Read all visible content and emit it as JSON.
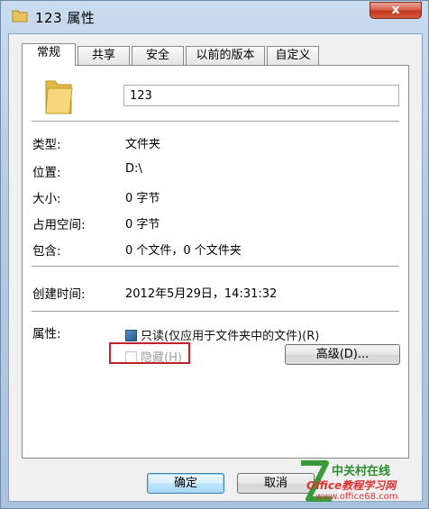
{
  "window": {
    "title": "123 属性",
    "close_glyph": "x"
  },
  "tabs": [
    {
      "label": "常规",
      "active": true
    },
    {
      "label": "共享",
      "active": false
    },
    {
      "label": "安全",
      "active": false
    },
    {
      "label": "以前的版本",
      "active": false
    },
    {
      "label": "自定义",
      "active": false
    }
  ],
  "general": {
    "folder_icon": "folder-icon",
    "name_value": "123",
    "type": {
      "label": "类型:",
      "value": "文件夹"
    },
    "location": {
      "label": "位置:",
      "value": "D:\\"
    },
    "size": {
      "label": "大小:",
      "value": "0 字节"
    },
    "size_on_disk": {
      "label": "占用空间:",
      "value": "0 字节"
    },
    "contains": {
      "label": "包含:",
      "value": "0 个文件，0 个文件夹"
    },
    "created": {
      "label": "创建时间:",
      "value": "2012年5月29日，14:31:32"
    },
    "attributes": {
      "label": "属性:",
      "readonly_label": "只读(仅应用于文件夹中的文件)(R)",
      "hidden_label": "隐藏(H)",
      "advanced_button": "高级(D)..."
    }
  },
  "footer": {
    "ok": "确定",
    "cancel": "取消"
  },
  "watermark": {
    "line1": "中关村在线",
    "line2": "Office教程学习网",
    "line3": "www.office68.com"
  },
  "colors": {
    "highlight_box": "#c0232f",
    "title_bg": "#c9dbef",
    "close_button": "#c0391f"
  }
}
